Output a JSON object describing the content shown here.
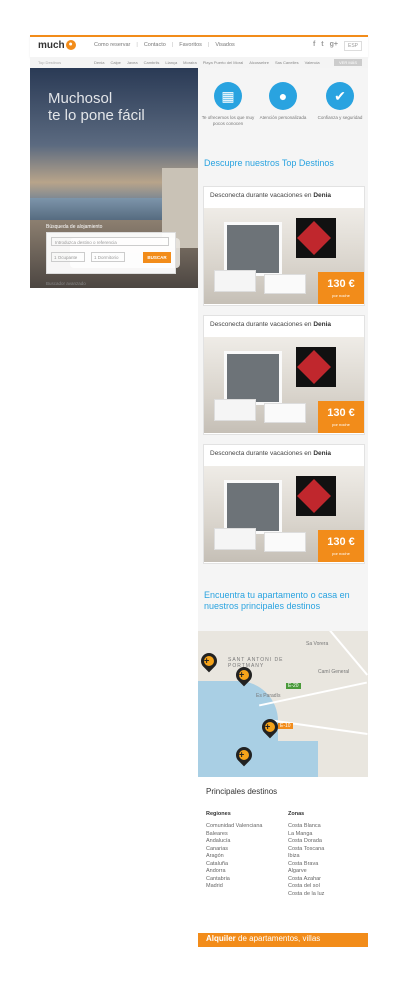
{
  "header": {
    "logo": "much",
    "logo_sun": "sol",
    "nav": [
      "Como reservar",
      "Contacto",
      "Favoritos",
      "Visados"
    ],
    "social": [
      "f",
      "t",
      "g+"
    ],
    "lang": "ESP"
  },
  "subnav": {
    "label": "Top Destinos",
    "items": [
      "Denia",
      "Calpe",
      "Javea",
      "Cambrils",
      "Llança",
      "Moraira",
      "Playa Puerto del Moral",
      "Alcossebre",
      "Sas Canelles",
      "Valencia"
    ],
    "button": "VER MÁS"
  },
  "hero": {
    "title_line1": "Muchosol",
    "title_line2": "te lo pone fácil",
    "search_label": "Búsqueda de alojamiento",
    "dest_placeholder": "Introduzca destino o referencia",
    "occupants": "1 Ocupante",
    "bedrooms": "1 Dormitorio",
    "search_button": "BUSCAR",
    "advanced": "Buscador avanzado"
  },
  "features": [
    {
      "icon": "map-icon",
      "glyph": "▦",
      "text": "Te ofrecemos los que muy pocos conocen"
    },
    {
      "icon": "person-icon",
      "glyph": "●",
      "text": "Atención personalizada"
    },
    {
      "icon": "lock-icon",
      "glyph": "✔",
      "text": "Confianza y seguridad"
    }
  ],
  "top_title": "Descupre nuestros Top Destinos",
  "cards": [
    {
      "prefix": "Desconecta durante vacaciones en ",
      "city": "Denia",
      "price": "130 €",
      "per": "por noche"
    },
    {
      "prefix": "Desconecta durante vacaciones en ",
      "city": "Denia",
      "price": "130 €",
      "per": "por noche"
    },
    {
      "prefix": "Desconecta durante vacaciones en ",
      "city": "Denia",
      "price": "130 €",
      "per": "por noche"
    }
  ],
  "map_title": "Encuentra tu apartamento o casa en nuestros principales destinos",
  "map": {
    "label1": "SANT ANTONI DE PORTMANY",
    "label2": "Camí General",
    "label3": "Es Paradís",
    "label4": "Sa Vorera",
    "road1": "E-20",
    "road2": "E-10"
  },
  "principal": {
    "title": "Principales destinos",
    "regions_title": "Regiones",
    "regions": [
      "Comunidad Valenciana",
      "Baleares",
      "Andalucía",
      "Canarias",
      "Aragón",
      "Cataluña",
      "Andorra",
      "Cantabria",
      "Madrid"
    ],
    "zones_title": "Zonas",
    "zones": [
      "Costa Blanca",
      "La Manga",
      "Costa Dorada",
      "Costa Toscana",
      "Ibiza",
      "Costa Brava",
      "Algarve",
      "Costa Azahar",
      "Costa del sol",
      "Costa de la luz"
    ]
  },
  "footer": {
    "bold": "Alquiler",
    "rest": " de apartamentos, villas"
  },
  "colors": {
    "accent": "#f28c1a",
    "blue": "#29a3e0"
  }
}
